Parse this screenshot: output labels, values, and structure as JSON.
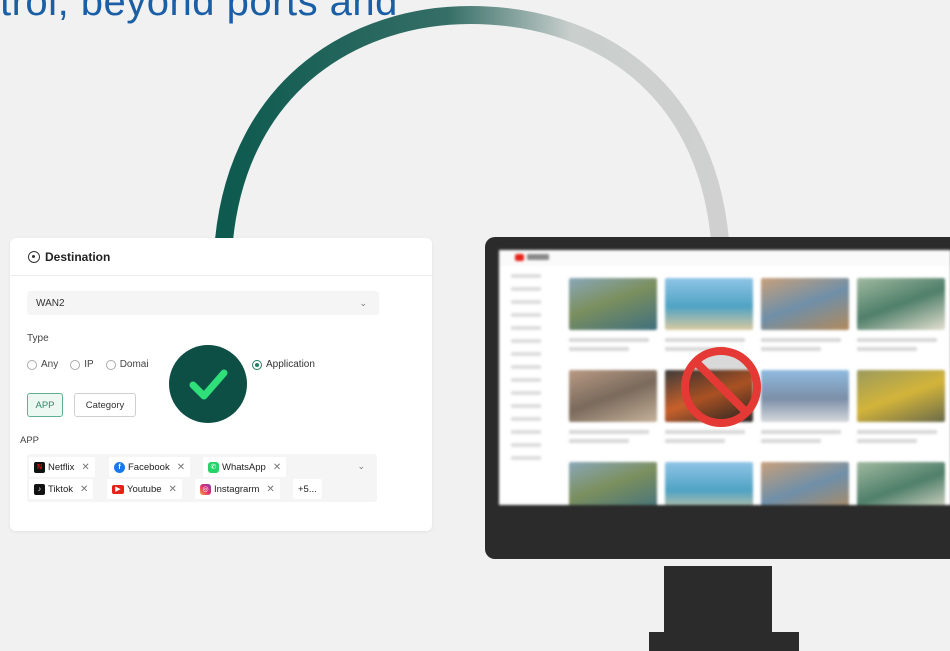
{
  "headline": "trol, beyond ports and",
  "panel": {
    "title": "Destination",
    "wan_select": "WAN2",
    "type_label": "Type",
    "type_options": [
      "Any",
      "IP",
      "Domai",
      "Application"
    ],
    "selected_type": "Application",
    "mode_buttons": {
      "app": "APP",
      "category": "Category"
    },
    "app_label": "APP",
    "apps": [
      "Netflix",
      "Facebook",
      "WhatsApp",
      "Tiktok",
      "Youtube",
      "Instagrarm"
    ],
    "more_count": "+5..."
  },
  "colors": {
    "accent_dark_green": "#0d4f45",
    "check_green": "#2fe07a",
    "headline_blue": "#1a5fa6",
    "blocked_red": "#e53935",
    "monitor": "#2b2b2b"
  },
  "icons": {
    "allowed": "checkmark-icon",
    "blocked": "prohibited-icon"
  }
}
